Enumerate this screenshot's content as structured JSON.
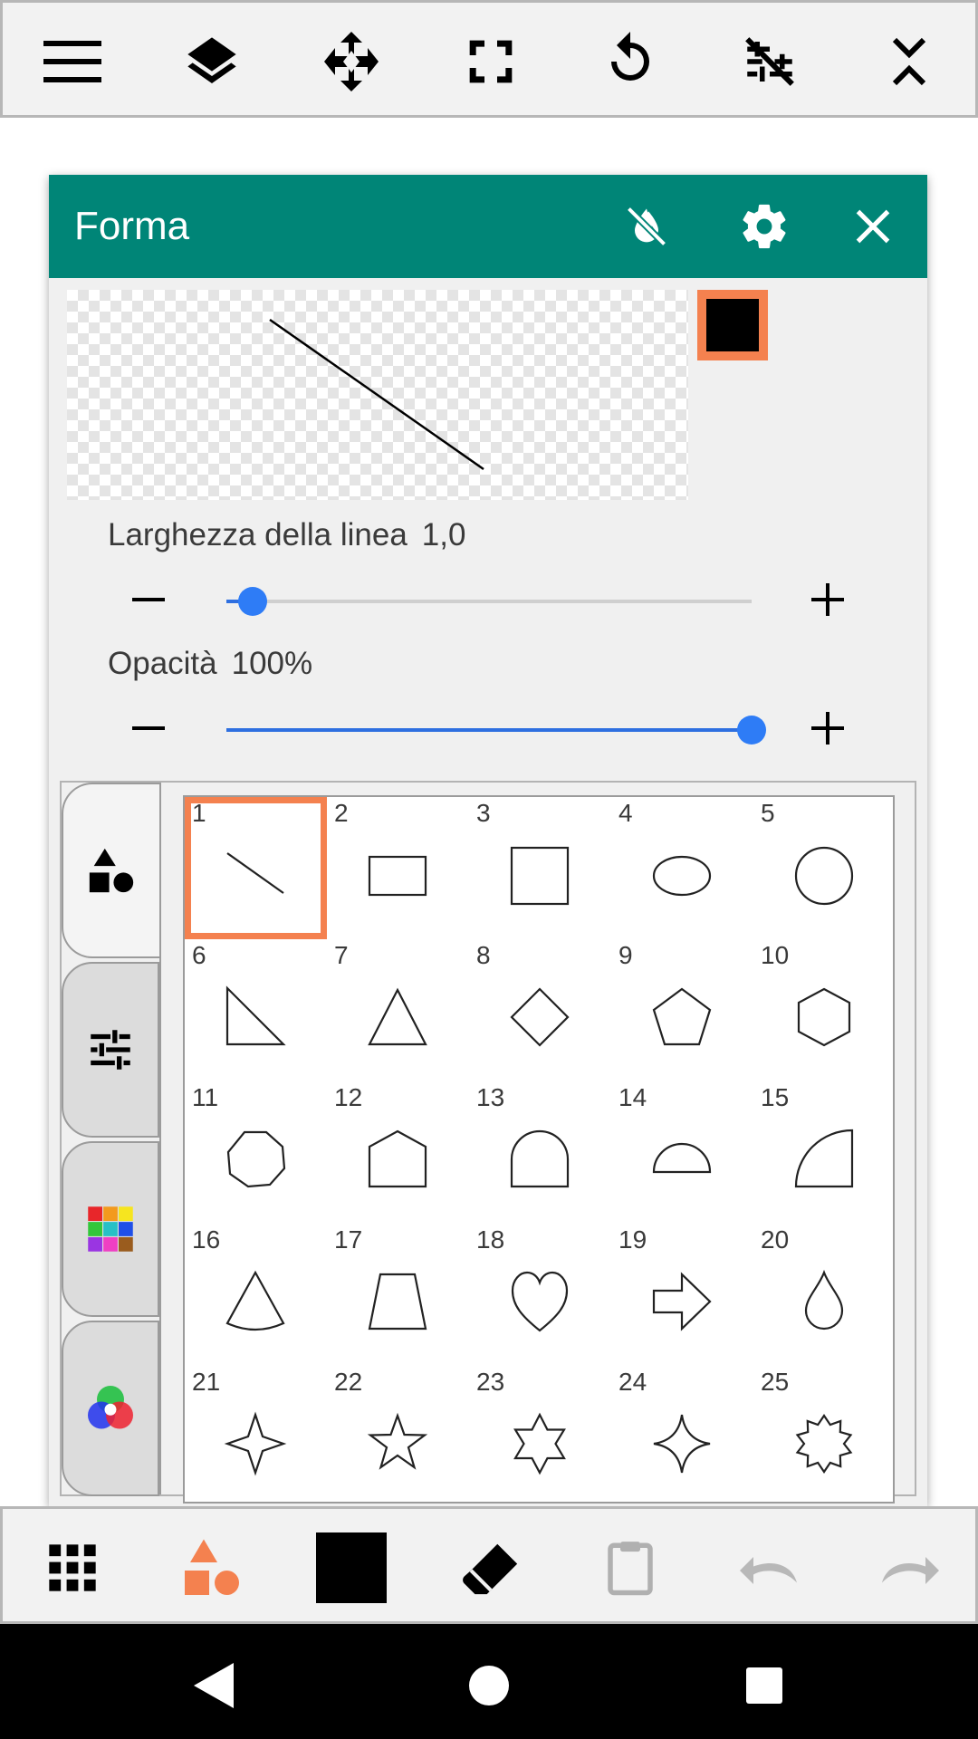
{
  "toolbar": {
    "icons": [
      "menu-icon",
      "layers-icon",
      "move-icon",
      "fullscreen-icon",
      "rotate-icon",
      "grid-off-icon",
      "collapse-icon"
    ]
  },
  "dialog": {
    "title": "Forma",
    "header_icons": [
      "opacity-off-icon",
      "settings-icon",
      "close-icon"
    ],
    "stroke_color": "#000000",
    "swatch_border_color": "#f4814f",
    "line_width": {
      "label": "Larghezza della linea",
      "value": "1,0",
      "fraction": 0.05
    },
    "opacity": {
      "label": "Opacità",
      "value": "100%",
      "fraction": 1.0
    },
    "minus_label": "−",
    "plus_label": "+",
    "side_tabs": [
      "shapes-icon",
      "adjust-icon",
      "palette-icon",
      "color-wheel-icon"
    ],
    "active_side_tab": 0,
    "selected_shape": 1,
    "shapes": [
      {
        "num": "1",
        "icon": "line-shape-icon"
      },
      {
        "num": "2",
        "icon": "rectangle-shape-icon"
      },
      {
        "num": "3",
        "icon": "square-shape-icon"
      },
      {
        "num": "4",
        "icon": "ellipse-shape-icon"
      },
      {
        "num": "5",
        "icon": "circle-shape-icon"
      },
      {
        "num": "6",
        "icon": "right-triangle-shape-icon"
      },
      {
        "num": "7",
        "icon": "triangle-shape-icon"
      },
      {
        "num": "8",
        "icon": "diamond-shape-icon"
      },
      {
        "num": "9",
        "icon": "pentagon-shape-icon"
      },
      {
        "num": "10",
        "icon": "hexagon-shape-icon"
      },
      {
        "num": "11",
        "icon": "octagon-shape-icon"
      },
      {
        "num": "12",
        "icon": "house-pentagon-shape-icon"
      },
      {
        "num": "13",
        "icon": "arch-shape-icon"
      },
      {
        "num": "14",
        "icon": "half-circle-shape-icon"
      },
      {
        "num": "15",
        "icon": "quarter-circle-shape-icon"
      },
      {
        "num": "16",
        "icon": "cone-shape-icon"
      },
      {
        "num": "17",
        "icon": "trapezoid-shape-icon"
      },
      {
        "num": "18",
        "icon": "heart-shape-icon"
      },
      {
        "num": "19",
        "icon": "arrow-shape-icon"
      },
      {
        "num": "20",
        "icon": "drop-shape-icon"
      },
      {
        "num": "21",
        "icon": "four-point-star-shape-icon"
      },
      {
        "num": "22",
        "icon": "five-point-star-shape-icon"
      },
      {
        "num": "23",
        "icon": "six-point-star-shape-icon"
      },
      {
        "num": "24",
        "icon": "sparkle-star-shape-icon"
      },
      {
        "num": "25",
        "icon": "burst-star-shape-icon"
      }
    ]
  },
  "bottombar": {
    "icons": [
      "apps-grid-icon",
      "shapes-tool-icon",
      "color-icon",
      "eraser-icon",
      "clipboard-icon",
      "undo-icon",
      "redo-icon"
    ],
    "accent_color": "#f4814f",
    "current_color": "#000000"
  },
  "navbar": {
    "icons": [
      "back-icon",
      "home-icon",
      "recents-icon"
    ]
  }
}
